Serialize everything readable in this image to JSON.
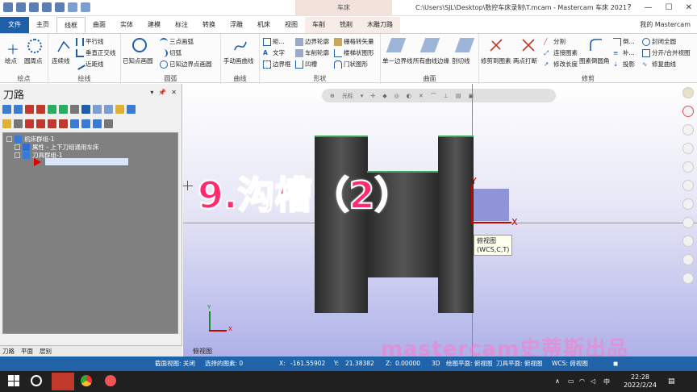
{
  "titlebar": {
    "context_tab": "车床",
    "title": "C:\\Users\\SJL\\Desktop\\数控车床录制\\T.mcam - Mastercam 车床 2021",
    "controls": [
      "?",
      "—",
      "☐",
      "✕"
    ]
  },
  "tabs": [
    "文件",
    "主页",
    "线框",
    "曲面",
    "实体",
    "建模",
    "标注",
    "转换",
    "浮雕",
    "机床",
    "视图",
    "车削",
    "铣削",
    "木雕刀路"
  ],
  "user": "我的 Mastercam",
  "ribbon": {
    "groups": [
      {
        "label": "绘点",
        "buttons": [
          "绘点",
          "圆周点"
        ]
      },
      {
        "label": "绘线",
        "buttons": [
          "连续线",
          "平行线",
          "垂直正交线",
          "近距线"
        ]
      },
      {
        "label": "圆弧",
        "buttons": [
          "已知点画圆",
          "三点画弧",
          "切弧",
          "已知边界点画圆"
        ]
      },
      {
        "label": "曲线",
        "buttons": [
          "手动画曲线"
        ]
      },
      {
        "label": "形状",
        "buttons": [
          "矩...",
          "文字",
          "边界框",
          "边界轮廓",
          "车削轮廓",
          "凹槽",
          "栅格转矢量",
          "楼梯状图形",
          "门状图形"
        ]
      },
      {
        "label": "曲面",
        "buttons": [
          "单一边界线",
          "所有曲线边缘",
          "剖切线"
        ]
      },
      {
        "label": "修剪",
        "buttons": [
          "修剪到图素",
          "两点打断",
          "分割",
          "连接图素",
          "修改长度",
          "图素倒圆角",
          "倒...",
          "补...",
          "投影",
          "封闭全圆",
          "分开/合并视图",
          "修复曲线"
        ]
      }
    ]
  },
  "panel": {
    "title": "刀路",
    "controls": [
      "▾",
      "📌",
      "✕"
    ],
    "tree": [
      {
        "label": "机床群组-1"
      },
      {
        "label": "属性 - 上下刀组通用车床"
      },
      {
        "label": "刀具群组-1"
      }
    ],
    "tabs": [
      "刀路",
      "平面",
      "层别"
    ]
  },
  "viewport": {
    "toolbar": [
      "光标",
      "▾"
    ],
    "overlay_title": "9.沟槽（2）",
    "tooltip_line1": "俯视图",
    "tooltip_line2": "(WCS,C,T)",
    "view_name": "俯视图",
    "watermark": "mastercam史蒂斯出品",
    "axis_x": "X",
    "axis_y": "Y"
  },
  "statusbar": {
    "section_view": "截面视图: 关闭",
    "selected": "选择的图素: 0",
    "x_label": "X:",
    "x_value": "-161.55902",
    "y_label": "Y:",
    "y_value": "21.38382",
    "z_label": "Z:",
    "z_value": "0.00000",
    "mode": "3D",
    "draw_plane": "绘图平面: 俯视图",
    "tool_plane": "刀具平面: 俯视图",
    "wcs": "WCS: 俯视图"
  },
  "taskbar": {
    "time": "22:28",
    "date": "2022/2/24",
    "ime": "中"
  },
  "colors": {
    "file_tab": "#1f5fa8",
    "statusbar": "#2163a8",
    "overlay_text": "#ff2b6e",
    "part_edge": "#3fa65a",
    "taskbar": "#202020"
  }
}
